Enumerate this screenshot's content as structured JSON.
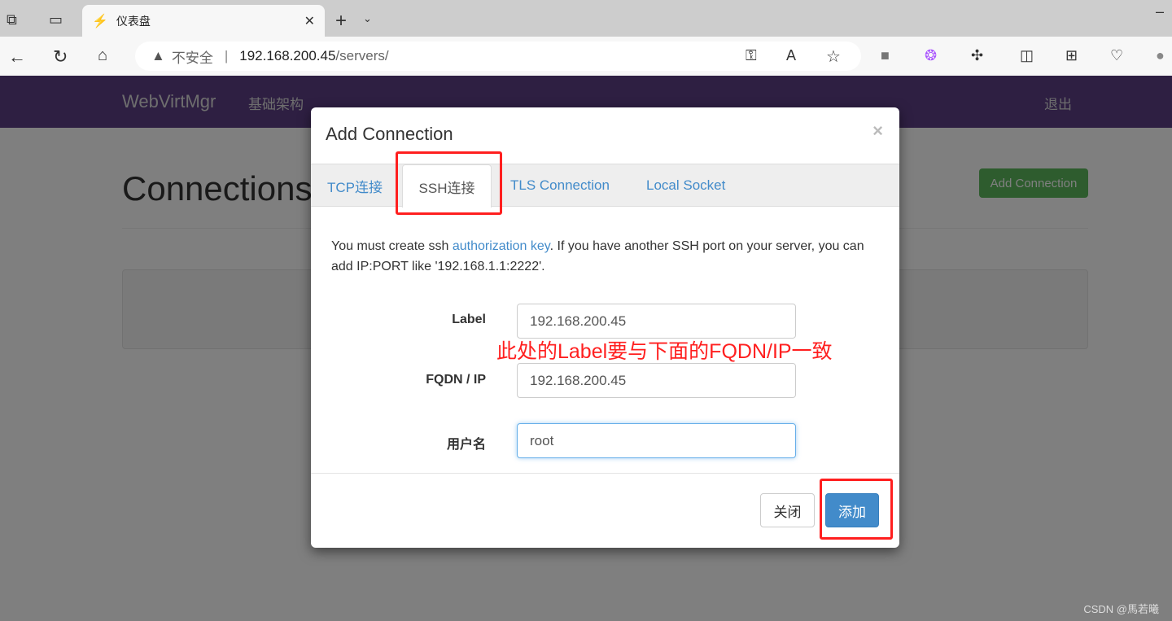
{
  "browser": {
    "tab_title": "仪表盘",
    "address": {
      "insecure_label": "不安全",
      "host": "192.168.200.45",
      "path": "/servers/"
    },
    "icons": [
      "workspaces-icon",
      "tab-actions-icon",
      "back-icon",
      "refresh-icon",
      "home-icon",
      "key-icon",
      "read-aloud-icon",
      "favorite-star-icon",
      "extension-icon",
      "copilot-icon",
      "extensions-icon",
      "split-screen-icon",
      "collections-icon",
      "browser-essentials-icon",
      "profile-icon"
    ]
  },
  "navbar": {
    "brand": "WebVirtMgr",
    "links": [
      "基础架构"
    ],
    "logout": "退出",
    "color": "#5c3f84"
  },
  "page": {
    "title": "Connections",
    "add_button": "Add Connection"
  },
  "modal": {
    "title": "Add Connection",
    "close": "×",
    "tabs": [
      {
        "label": "TCP连接"
      },
      {
        "label": "SSH连接",
        "active": true
      },
      {
        "label": "TLS Connection"
      },
      {
        "label": "Local Socket"
      }
    ],
    "description": {
      "before": "You must create ssh ",
      "link": "authorization key",
      "after": ". If you have another SSH port on your server, you can add IP:PORT like '192.168.1.1:2222'."
    },
    "fields": {
      "label": {
        "label": "Label",
        "value": "192.168.200.45"
      },
      "fqdn": {
        "label": "FQDN / IP",
        "value": "192.168.200.45"
      },
      "username": {
        "label": "用户名",
        "value": "root"
      }
    },
    "close_button": "关闭",
    "add_button": "添加"
  },
  "annotation": {
    "note": "此处的Label要与下面的FQDN/IP一致",
    "color": "#ff1f1f"
  },
  "watermark": "CSDN @馬若曦"
}
